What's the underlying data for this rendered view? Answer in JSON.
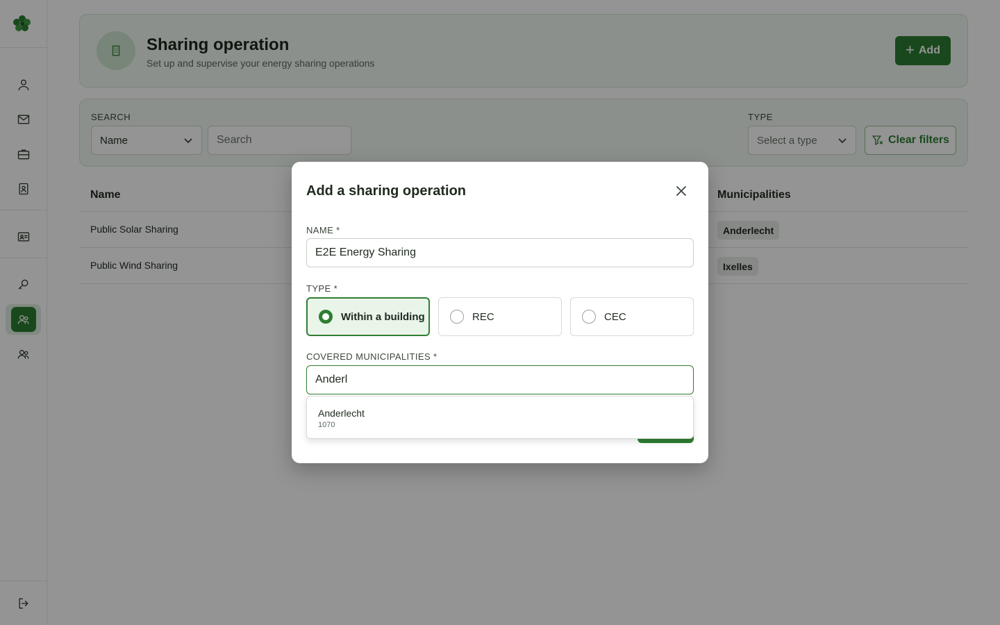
{
  "header": {
    "title": "Sharing operation",
    "subtitle": "Set up and supervise your energy sharing operations",
    "add_label": "Add"
  },
  "filters": {
    "search_label": "SEARCH",
    "search_field_value": "Name",
    "search_placeholder": "Search",
    "type_label": "TYPE",
    "type_placeholder": "Select a type",
    "clear_label": "Clear filters"
  },
  "table": {
    "columns": {
      "name": "Name",
      "municipalities": "Municipalities"
    },
    "rows": [
      {
        "name": "Public Solar Sharing",
        "municipality": "Anderlecht"
      },
      {
        "name": "Public Wind Sharing",
        "municipality": "Ixelles"
      }
    ]
  },
  "modal": {
    "title": "Add a sharing operation",
    "name_label": "NAME *",
    "name_value": "E2E Energy Sharing",
    "type_label": "TYPE *",
    "type_options": [
      {
        "label": "Within a building",
        "selected": true
      },
      {
        "label": "REC",
        "selected": false
      },
      {
        "label": "CEC",
        "selected": false
      }
    ],
    "municipalities_label": "COVERED MUNICIPALITIES *",
    "municipalities_value": "Anderl",
    "suggestions": [
      {
        "name": "Anderlecht",
        "code": "1070"
      }
    ]
  },
  "colors": {
    "accent": "#2e7d32",
    "accent_light": "#eaf5ea",
    "overlay": "rgba(0,0,0,0.42)"
  },
  "icons": {
    "sidebar": [
      "user-icon",
      "mail-icon",
      "briefcase-icon",
      "contact-book-icon",
      "id-card-icon",
      "search-key-icon",
      "group-icon",
      "users-icon",
      "logout-icon"
    ]
  }
}
